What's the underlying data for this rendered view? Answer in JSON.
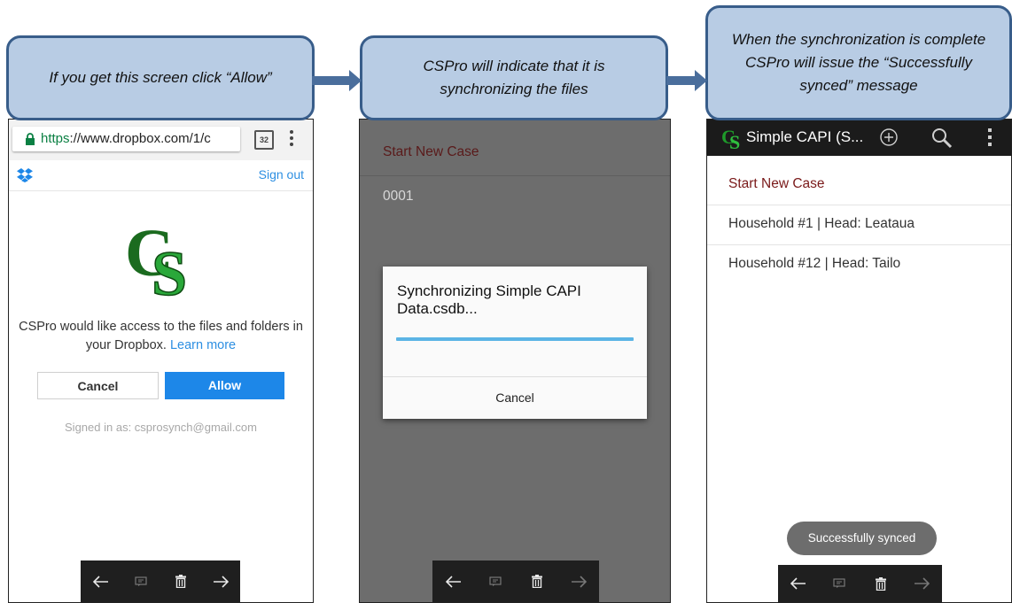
{
  "callouts": {
    "step1": "If you get this screen click “Allow”",
    "step2": "CSPro will indicate that it is synchronizing the files",
    "step3": "When the synchronization is complete CSPro will issue the “Successfully synced” message"
  },
  "browser": {
    "url_scheme": "https",
    "url_rest": "://www.dropbox.com/1/c",
    "tab_count": "32"
  },
  "dropbox": {
    "sign_out": "Sign out",
    "logo_text": "CS",
    "access_text": "CSPro would like access to the files and folders in your Dropbox.",
    "learn_more": "Learn more",
    "cancel": "Cancel",
    "allow": "Allow",
    "signed_in": "Signed in as: csprosynch@gmail.com"
  },
  "sync_screen": {
    "start_new_case": "Start New Case",
    "case_id": "0001",
    "dialog_title": "Synchronizing Simple CAPI Data.csdb...",
    "progress": 1.0,
    "dialog_cancel": "Cancel"
  },
  "synced_screen": {
    "app_title": "Simple CAPI (S...",
    "start_new_case": "Start New Case",
    "cases": [
      "Household #1 | Head: Leataua",
      "Household #12 | Head: Tailo"
    ],
    "toast": "Successfully synced"
  },
  "nav_icons": [
    "back-arrow-icon",
    "notes-icon",
    "delete-icon",
    "forward-arrow-icon"
  ],
  "colors": {
    "callout_fill": "#b8cce4",
    "callout_border": "#385d8a",
    "dropbox_blue": "#1d87e8",
    "link_blue": "#2d8fe2",
    "cspro_green": "#1e9a2a",
    "progress_blue": "#5bb4e5",
    "dim_overlay": "#6d6d6d"
  }
}
